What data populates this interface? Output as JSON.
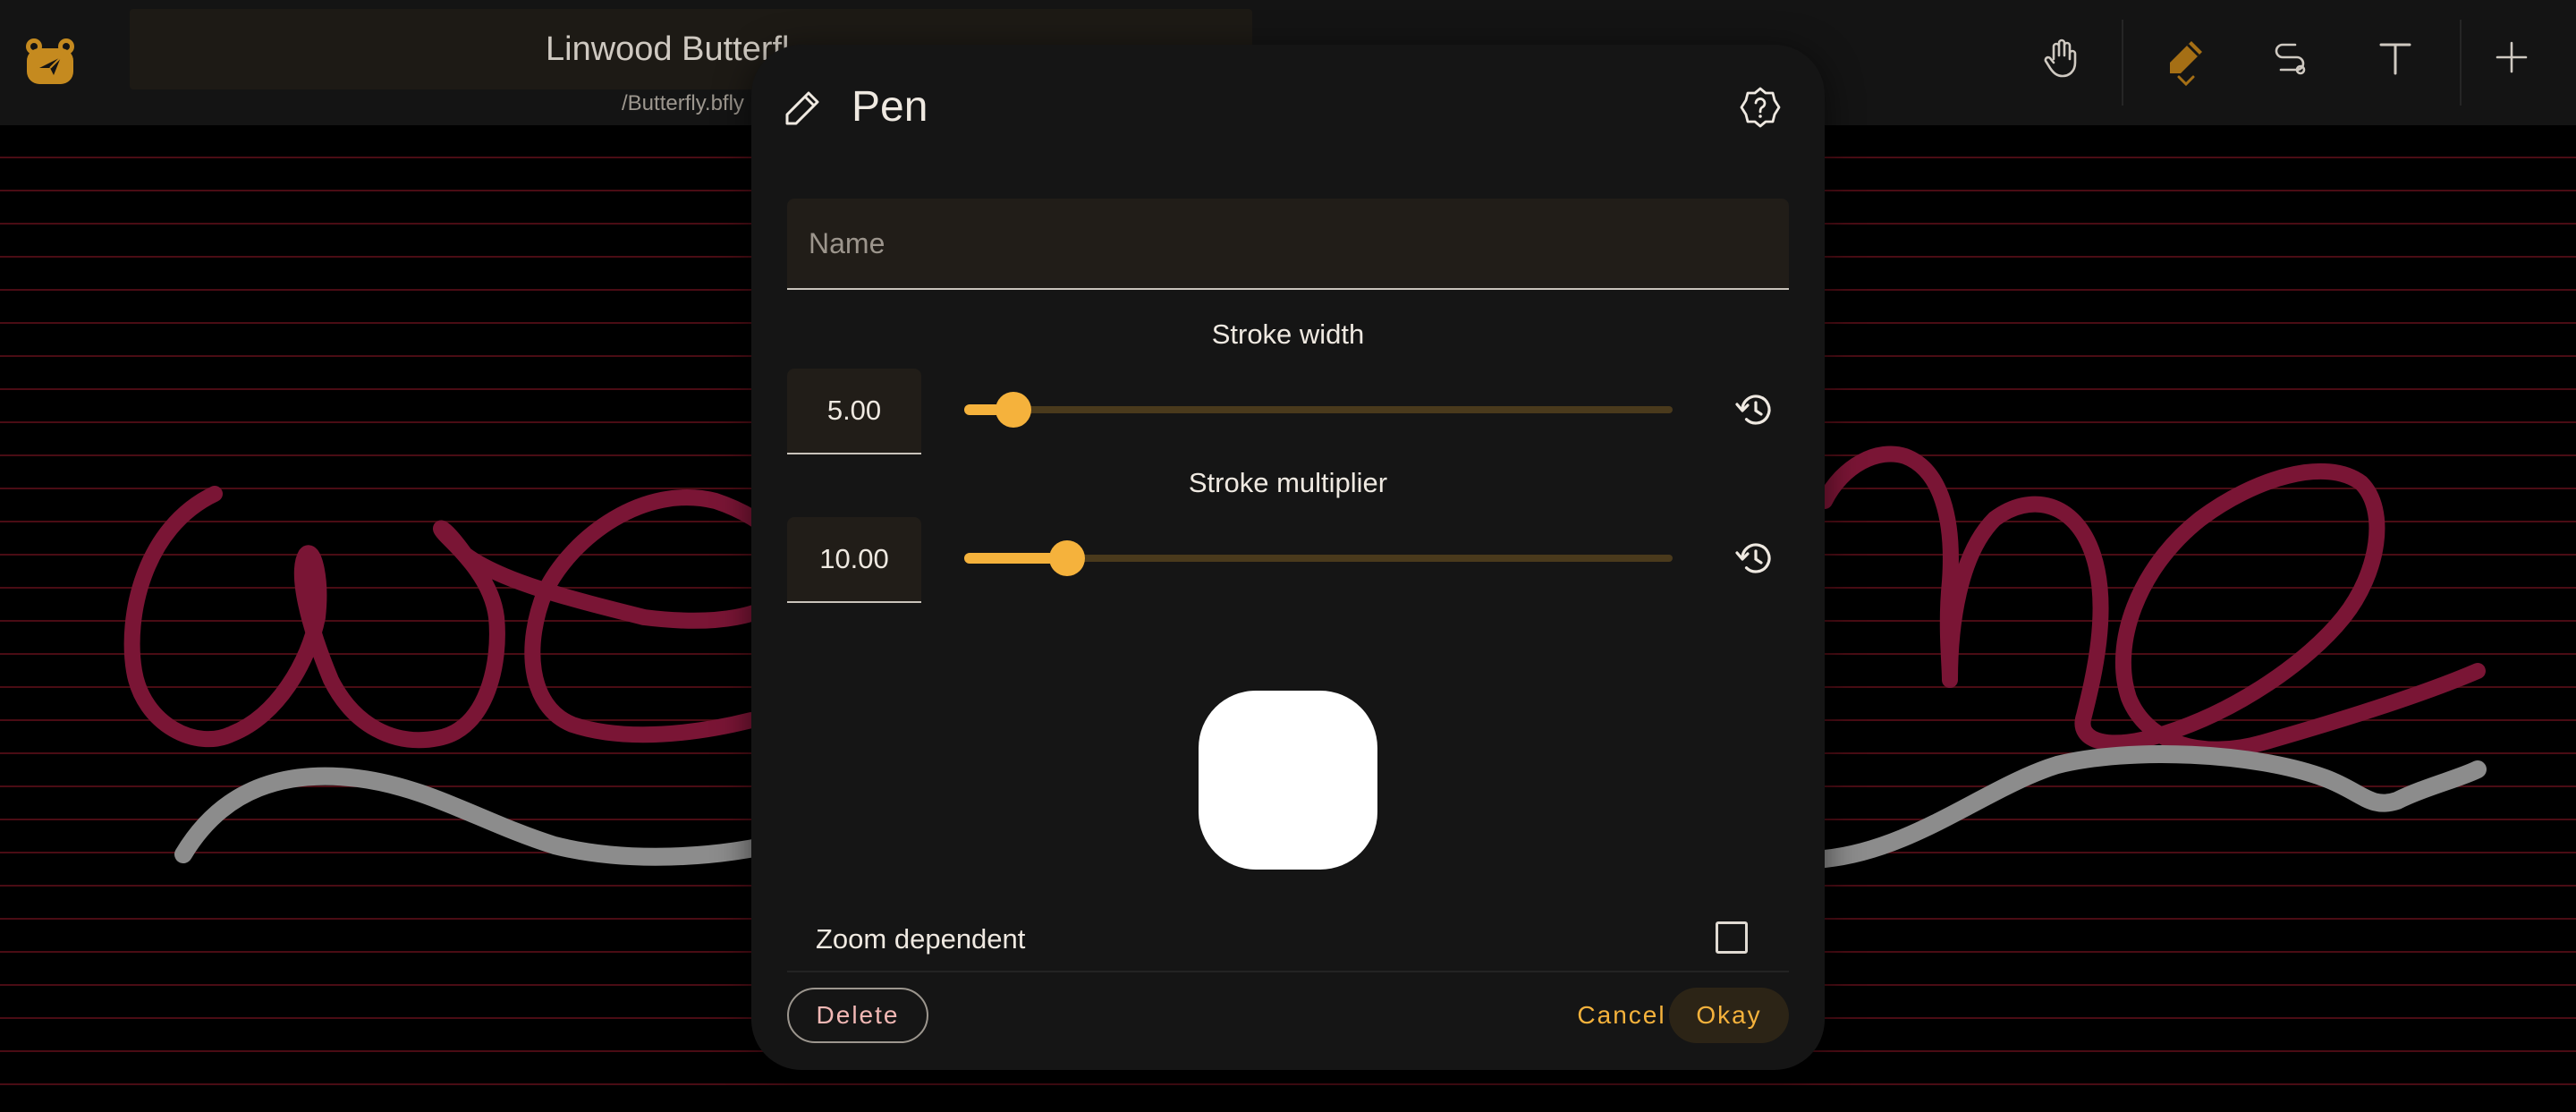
{
  "header": {
    "document_title": "Linwood Butterfl",
    "document_path": "/Butterfly.bfly",
    "logo": "linwood-butterfly-logo",
    "tools": [
      {
        "name": "hand-icon"
      },
      {
        "name": "pen-icon",
        "selected": true
      },
      {
        "name": "path-icon"
      },
      {
        "name": "text-icon"
      },
      {
        "name": "add-icon"
      }
    ]
  },
  "dialog": {
    "title": "Pen",
    "icon": "pen-icon",
    "help_icon": "help-icon",
    "name_field": {
      "placeholder": "Name",
      "value": ""
    },
    "stroke_width": {
      "label": "Stroke width",
      "value": "5.00",
      "fraction": 0.07
    },
    "stroke_multiplier": {
      "label": "Stroke multiplier",
      "value": "10.00",
      "fraction": 0.145
    },
    "zoom_dependent": {
      "label": "Zoom dependent",
      "checked": false
    },
    "buttons": {
      "delete": "Delete",
      "cancel": "Cancel",
      "okay": "Okay"
    }
  },
  "colors": {
    "accent": "#f5b23c",
    "stroke_red": "#7a1535",
    "stroke_gray": "#8c8c8c",
    "dialog_bg": "#151515"
  }
}
